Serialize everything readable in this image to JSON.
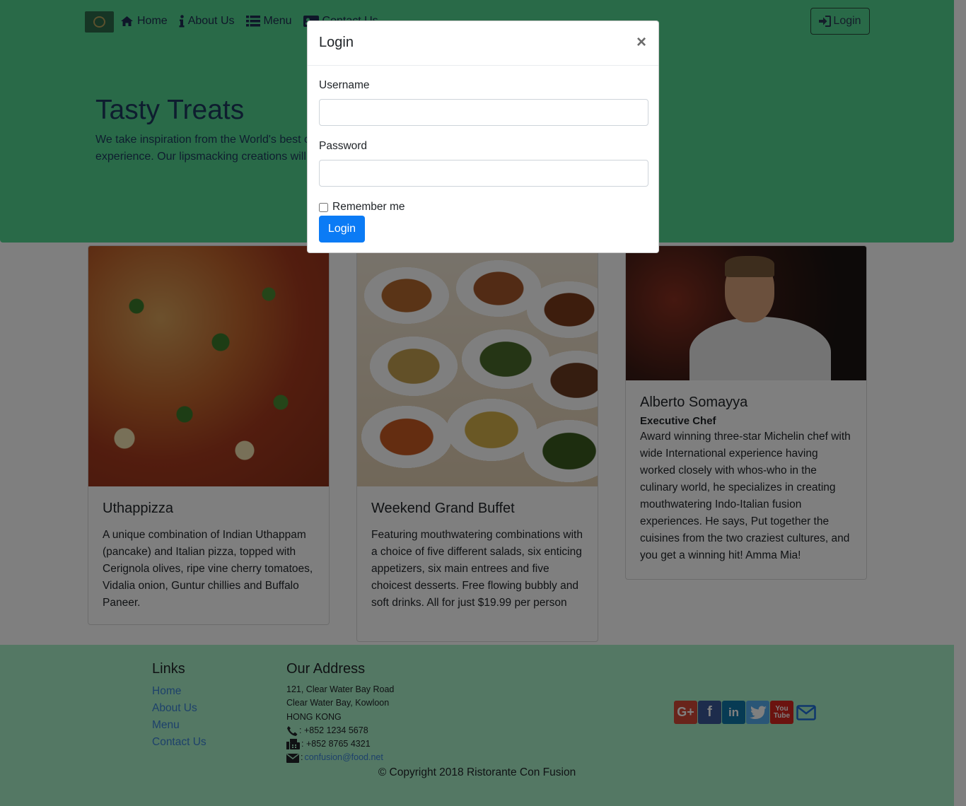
{
  "navbar": {
    "items": [
      {
        "label": "Home",
        "icon": "home-icon"
      },
      {
        "label": "About Us",
        "icon": "info-icon"
      },
      {
        "label": "Menu",
        "icon": "list-icon"
      },
      {
        "label": "Contact Us",
        "icon": "address-card-icon"
      }
    ],
    "login_label": "Login"
  },
  "jumbotron": {
    "title": "Tasty Treats",
    "text": "We take inspiration from the World's best cuisines, and create a unique fusion experience. Our lipsmacking creations will tickle your culinary senses!"
  },
  "cards": [
    {
      "title": "Uthappizza",
      "text": "A unique combination of Indian Uthappam (pancake) and Italian pizza, topped with Cerignola olives, ripe vine cherry tomatoes, Vidalia onion, Guntur chillies and Buffalo Paneer."
    },
    {
      "title": "Weekend Grand Buffet",
      "text": "Featuring mouthwatering combinations with a choice of five different salads, six enticing appetizers, six main entrees and five choicest desserts. Free flowing bubbly and soft drinks. All for just $19.99 per person"
    },
    {
      "title": "Alberto Somayya",
      "subtitle": "Executive Chef",
      "text": "Award winning three-star Michelin chef with wide International experience having worked closely with whos-who in the culinary world, he specializes in creating mouthwatering Indo-Italian fusion experiences. He says, Put together the cuisines from the two craziest cultures, and you get a winning hit! Amma Mia!"
    }
  ],
  "footer": {
    "links_title": "Links",
    "links": [
      "Home",
      "About Us",
      "Menu",
      "Contact Us"
    ],
    "address_title": "Our Address",
    "address_lines": [
      "121, Clear Water Bay Road",
      "Clear Water Bay, Kowloon",
      "HONG KONG"
    ],
    "phone": ": +852 1234 5678",
    "fax": ": +852 8765 4321",
    "email_sep": ":",
    "email": "confusion@food.net",
    "social": [
      "google-plus-icon",
      "facebook-icon",
      "linkedin-icon",
      "twitter-icon",
      "youtube-icon",
      "envelope-icon"
    ],
    "copyright": "© Copyright 2018 Ristorante Con Fusion"
  },
  "modal": {
    "title": "Login",
    "close": "×",
    "username_label": "Username",
    "username_value": "",
    "password_label": "Password",
    "password_value": "",
    "remember_label": "Remember me",
    "remember_checked": false,
    "submit_label": "Login"
  },
  "colors": {
    "header_bg": "#53d490",
    "footer_bg": "#a8f0c8",
    "primary": "#0b7bf5"
  }
}
